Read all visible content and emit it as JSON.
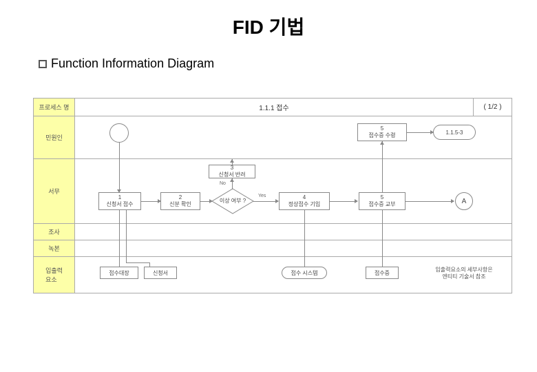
{
  "title": "FID 기법",
  "subtitle": "Function Information Diagram",
  "header": {
    "process_label": "프로세스 명",
    "process_name": "1.1.1 접수",
    "page": "( 1/2 )"
  },
  "lanes": {
    "r1": "민원인",
    "r2": "서무",
    "r3": "조사",
    "r4": "녹본",
    "r5": "입출력\n요소"
  },
  "r1": {
    "box1": {
      "num": "5",
      "txt": "접수증 수령"
    },
    "box2": {
      "num": "",
      "txt": "1.1.5-3"
    }
  },
  "r2": {
    "b1": {
      "num": "1",
      "txt": "신청서 접수"
    },
    "b2": {
      "num": "2",
      "txt": "신분 확인"
    },
    "b3": {
      "num": "3",
      "txt": "신청서 반려"
    },
    "dec": {
      "txt": "이상 여부 ?",
      "no": "No",
      "yes": "Yes"
    },
    "b4": {
      "num": "4",
      "txt": "정상접수 기입"
    },
    "b5": {
      "num": "5",
      "txt": "접수증 교부"
    },
    "a": "A"
  },
  "r5": {
    "o1": "접수대장",
    "o2": "신청서",
    "o3": "접수 시스템",
    "o4": "접수증",
    "note": "입출력요소의 세부사항은\n엔티티 기술서 참조"
  }
}
